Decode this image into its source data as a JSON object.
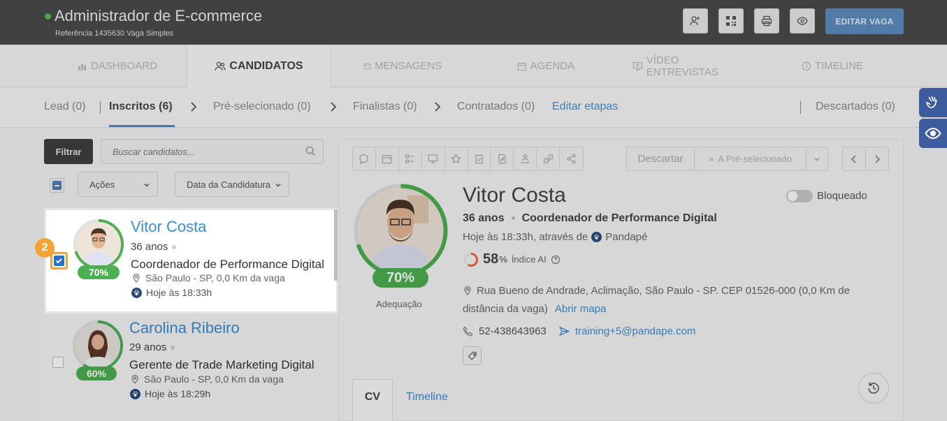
{
  "header": {
    "title": "Administrador de E-commerce",
    "subtitle": "Referência 1435630 Vaga Simples",
    "edit_button": "EDITAR VAGA",
    "status_color": "#5cb85c"
  },
  "nav": {
    "tabs": [
      {
        "label": "DASHBOARD",
        "icon": "bar-chart-icon"
      },
      {
        "label": "CANDIDATOS",
        "icon": "users-icon",
        "active": true
      },
      {
        "label": "MENSAGENS",
        "icon": "envelope-icon"
      },
      {
        "label": "AGENDA",
        "icon": "calendar-icon"
      },
      {
        "label": "VÍDEO ENTREVISTAS",
        "icon": "video-icon"
      },
      {
        "label": "TIMELINE",
        "icon": "clock-icon"
      }
    ]
  },
  "stages": {
    "lead": "Lead (0)",
    "inscritos": "Inscritos (6)",
    "pre_selecionado": "Pré-selecionado (0)",
    "finalistas": "Finalistas (0)",
    "contratados": "Contratados (0)",
    "edit_link": "Editar etapas",
    "descartados": "Descartados (0)"
  },
  "filters": {
    "filter_button": "Filtrar",
    "search_placeholder": "Buscar candidatos...",
    "actions_label": "Ações",
    "date_label": "Data da Candidatura"
  },
  "candidates": [
    {
      "name": "Vitor Costa",
      "age": "36 anos",
      "role": "Coordenador de Performance Digital",
      "location": "São Paulo - SP, 0,0 Km da vaga",
      "date": "Hoje às 18:33h",
      "match": "70%",
      "match_value": 70,
      "selected": true
    },
    {
      "name": "Carolina Ribeiro",
      "age": "29 anos",
      "role": "Gerente de Trade Marketing Digital",
      "location": "São Paulo - SP, 0,0 Km da vaga",
      "date": "Hoje às 18:29h",
      "match": "60%",
      "match_value": 60,
      "selected": false
    }
  ],
  "tutorial": {
    "step": "2",
    "color": "#f4a334"
  },
  "detail": {
    "discard_label": "Descartar",
    "move_label": "A Pré-selecionado",
    "name": "Vitor Costa",
    "age": "36 anos",
    "role": "Coordenador de Performance Digital",
    "applied": "Hoje às 18:33h, através de",
    "source": "Pandapé",
    "ai_score": "58",
    "ai_score_value": 58,
    "ai_pct": "%",
    "ai_label": "Índice AI",
    "match": "70%",
    "match_value": 70,
    "match_label": "Adequação",
    "blocked_label": "Bloqueado",
    "address": "Rua Bueno de Andrade, Aclimação, São Paulo - SP. CEP 01526-000 (0,0 Km de distância da vaga)",
    "map_link": "Abrir mapa",
    "phone": "52-438643963",
    "email": "training+5@pandape.com",
    "tab_cv": "CV",
    "tab_timeline": "Timeline"
  },
  "colors": {
    "accent": "#3a8ed0",
    "match_green": "#4caf50",
    "ai_orange": "#f0643c",
    "dark_header": "#4a4a4a"
  }
}
